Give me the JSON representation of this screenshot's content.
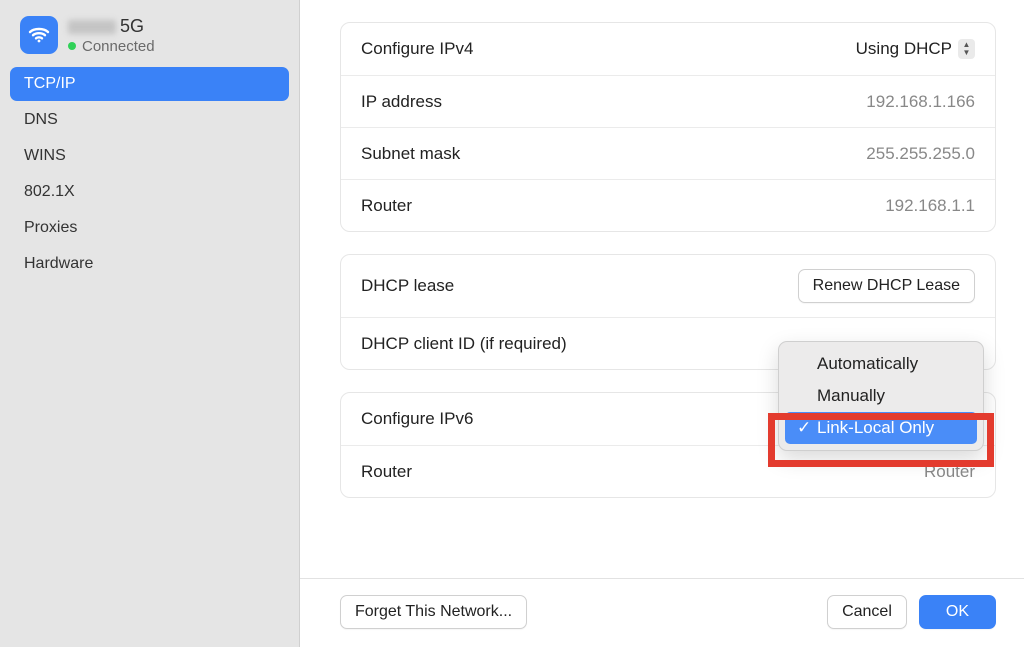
{
  "network": {
    "name_suffix": "5G",
    "status": "Connected"
  },
  "sidebar": {
    "items": [
      {
        "label": "TCP/IP",
        "selected": true
      },
      {
        "label": "DNS"
      },
      {
        "label": "WINS"
      },
      {
        "label": "802.1X"
      },
      {
        "label": "Proxies"
      },
      {
        "label": "Hardware"
      }
    ]
  },
  "group1": {
    "configure_ipv4_label": "Configure IPv4",
    "configure_ipv4_value": "Using DHCP",
    "ip_label": "IP address",
    "ip_value": "192.168.1.166",
    "subnet_label": "Subnet mask",
    "subnet_value": "255.255.255.0",
    "router_label": "Router",
    "router_value": "192.168.1.1"
  },
  "group2": {
    "lease_label": "DHCP lease",
    "renew_button": "Renew DHCP Lease",
    "client_id_label": "DHCP client ID (if required)"
  },
  "group3": {
    "configure_ipv6_label": "Configure IPv6",
    "router_label": "Router",
    "router_value": "Router"
  },
  "ipv6_menu": {
    "items": [
      {
        "label": "Automatically"
      },
      {
        "label": "Manually"
      },
      {
        "label": "Link-Local Only",
        "checked": true,
        "highlighted": true
      }
    ]
  },
  "footer": {
    "forget": "Forget This Network...",
    "cancel": "Cancel",
    "ok": "OK"
  }
}
